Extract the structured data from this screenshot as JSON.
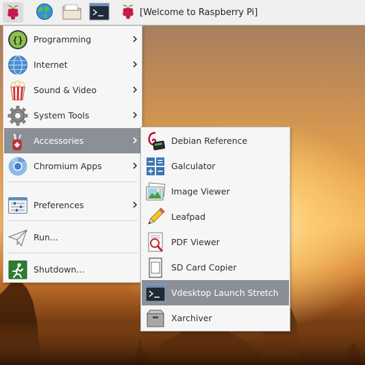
{
  "taskbar": {
    "menu_icon": "raspberry-icon",
    "launchers": [
      {
        "name": "web-browser",
        "icon": "globe-icon"
      },
      {
        "name": "file-manager",
        "icon": "folder-icon"
      },
      {
        "name": "terminal",
        "icon": "terminal-icon"
      }
    ],
    "window_title": "[Welcome to Raspberry Pi]"
  },
  "main_menu": {
    "items": [
      {
        "label": "Programming",
        "icon": "code-braces-icon",
        "submenu": true
      },
      {
        "label": "Internet",
        "icon": "globe-icon",
        "submenu": true
      },
      {
        "label": "Sound & Video",
        "icon": "popcorn-icon",
        "submenu": true
      },
      {
        "label": "System Tools",
        "icon": "gear-icon",
        "submenu": true
      },
      {
        "label": "Accessories",
        "icon": "swiss-knife-icon",
        "submenu": true,
        "selected": true
      },
      {
        "label": "Chromium Apps",
        "icon": "chromium-icon",
        "submenu": true
      },
      {
        "label": "Preferences",
        "icon": "preferences-icon",
        "submenu": true
      },
      {
        "label": "Run...",
        "icon": "paper-plane-icon",
        "submenu": false
      },
      {
        "label": "Shutdown...",
        "icon": "exit-icon",
        "submenu": false
      }
    ]
  },
  "accessories_menu": {
    "items": [
      {
        "label": "Debian Reference",
        "icon": "debian-icon"
      },
      {
        "label": "Galculator",
        "icon": "calculator-icon"
      },
      {
        "label": "Image Viewer",
        "icon": "image-icon"
      },
      {
        "label": "Leafpad",
        "icon": "pencil-icon"
      },
      {
        "label": "PDF Viewer",
        "icon": "pdf-magnifier-icon"
      },
      {
        "label": "SD Card Copier",
        "icon": "sd-card-icon"
      },
      {
        "label": "Vdesktop Launch Stretch",
        "icon": "terminal-icon",
        "selected": true
      },
      {
        "label": "Xarchiver",
        "icon": "archive-icon"
      }
    ]
  },
  "colors": {
    "highlight": "#8a9096",
    "menu_bg": "#f6f6f6",
    "taskbar_bg": "#f0f0f0",
    "raspberry_red": "#c51a4a",
    "leaf_green": "#75a928"
  }
}
